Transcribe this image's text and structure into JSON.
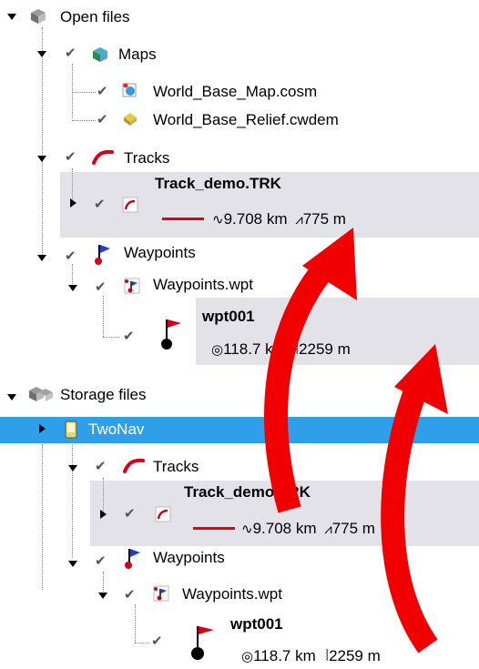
{
  "tree": {
    "open_files": {
      "label": "Open files",
      "maps": {
        "label": "Maps",
        "items": [
          "World_Base_Map.cosm",
          "World_Base_Relief.cwdem"
        ]
      },
      "tracks": {
        "label": "Tracks",
        "track": {
          "name": "Track_demo.TRK",
          "distance": "9.708 km",
          "elevation": "775 m"
        }
      },
      "waypoints": {
        "label": "Waypoints",
        "file": "Waypoints.wpt",
        "waypoint": {
          "name": "wpt001",
          "distance": "118.7 km",
          "altitude": "2259 m"
        }
      }
    },
    "storage_files": {
      "label": "Storage files",
      "device": "TwoNav",
      "tracks": {
        "label": "Tracks",
        "track": {
          "name": "Track_demo.TRK",
          "distance": "9.708 km",
          "elevation": "775 m"
        }
      },
      "waypoints": {
        "label": "Waypoints",
        "file": "Waypoints.wpt",
        "waypoint": {
          "name": "wpt001",
          "distance": "118.7 km",
          "altitude": "2259 m"
        }
      }
    }
  },
  "colors": {
    "selection": "#2f9fea",
    "panel": "#e2e2e8",
    "track_line": "#e0001a",
    "arrow": "#f00000"
  }
}
